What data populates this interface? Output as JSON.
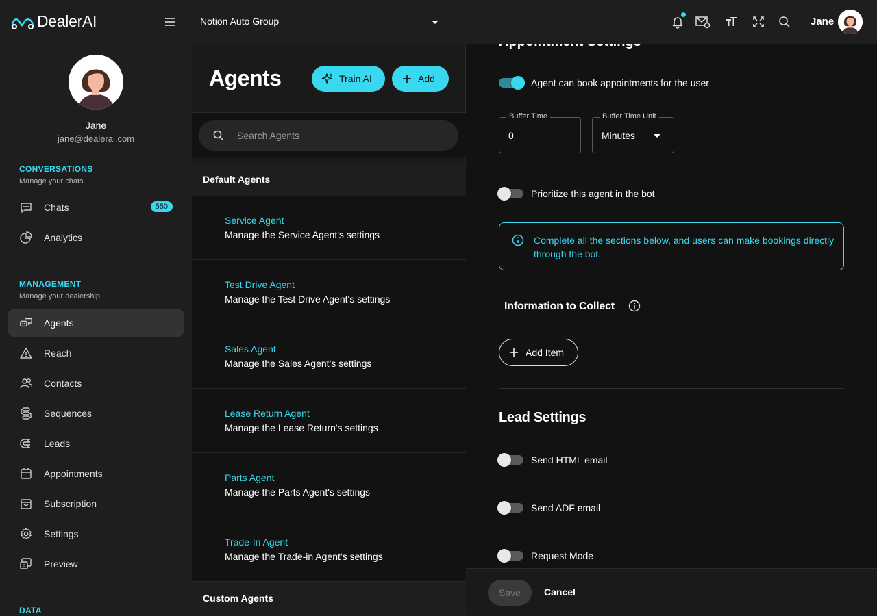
{
  "app": {
    "name": "DealerAI"
  },
  "header": {
    "organization": "Notion Auto Group",
    "username": "Jane"
  },
  "profile": {
    "name": "Jane",
    "email": "jane@dealerai.com"
  },
  "sidebar": {
    "sections": [
      {
        "title": "CONVERSATIONS",
        "subtitle": "Manage your chats"
      },
      {
        "title": "MANAGEMENT",
        "subtitle": "Manage your dealership"
      },
      {
        "title": "DATA"
      }
    ],
    "conversations": [
      {
        "label": "Chats",
        "icon": "chat-icon",
        "badge": "550"
      },
      {
        "label": "Analytics",
        "icon": "analytics-icon"
      }
    ],
    "management": [
      {
        "label": "Agents",
        "icon": "agents-icon",
        "active": true
      },
      {
        "label": "Reach",
        "icon": "reach-icon"
      },
      {
        "label": "Contacts",
        "icon": "contacts-icon"
      },
      {
        "label": "Sequences",
        "icon": "sequences-icon"
      },
      {
        "label": "Leads",
        "icon": "leads-icon"
      },
      {
        "label": "Appointments",
        "icon": "calendar-icon"
      },
      {
        "label": "Subscription",
        "icon": "subscription-icon"
      },
      {
        "label": "Settings",
        "icon": "gear-icon"
      },
      {
        "label": "Preview",
        "icon": "preview-icon"
      }
    ]
  },
  "agents_panel": {
    "title": "Agents",
    "train_label": "Train AI",
    "add_label": "Add",
    "search_placeholder": "Search Agents",
    "default_group": "Default Agents",
    "custom_group": "Custom Agents",
    "agents": [
      {
        "name": "Service Agent",
        "description": "Manage the Service Agent's settings"
      },
      {
        "name": "Test Drive Agent",
        "description": "Manage the Test Drive Agent's settings"
      },
      {
        "name": "Sales Agent",
        "description": "Manage the Sales Agent's settings"
      },
      {
        "name": "Lease Return Agent",
        "description": "Manage the Lease Return's settings"
      },
      {
        "name": "Parts Agent",
        "description": "Manage the Parts Agent's settings"
      },
      {
        "name": "Trade-In Agent",
        "description": "Manage the Trade-in Agent's settings"
      }
    ]
  },
  "settings": {
    "section_heading": "Appointment Settings",
    "book_toggle_label": "Agent can book appointments for the user",
    "book_toggle_on": true,
    "buffer_time_label": "Buffer Time",
    "buffer_time_value": "0",
    "buffer_unit_label": "Buffer Time Unit",
    "buffer_unit_value": "Minutes",
    "prioritize_label": "Prioritize this agent in the bot",
    "prioritize_on": false,
    "info_text": "Complete all the sections below, and users can make bookings directly through the bot.",
    "collect_title": "Information to Collect",
    "add_item_label": "Add Item",
    "lead_title": "Lead Settings",
    "lead_toggles": [
      {
        "label": "Send HTML email",
        "on": false
      },
      {
        "label": "Send ADF email",
        "on": false
      },
      {
        "label": "Request Mode",
        "on": false
      }
    ]
  },
  "footer": {
    "save_label": "Save",
    "cancel_label": "Cancel"
  },
  "colors": {
    "accent": "#38d9f0",
    "background": "#121212",
    "panel": "#1e1e1e"
  }
}
